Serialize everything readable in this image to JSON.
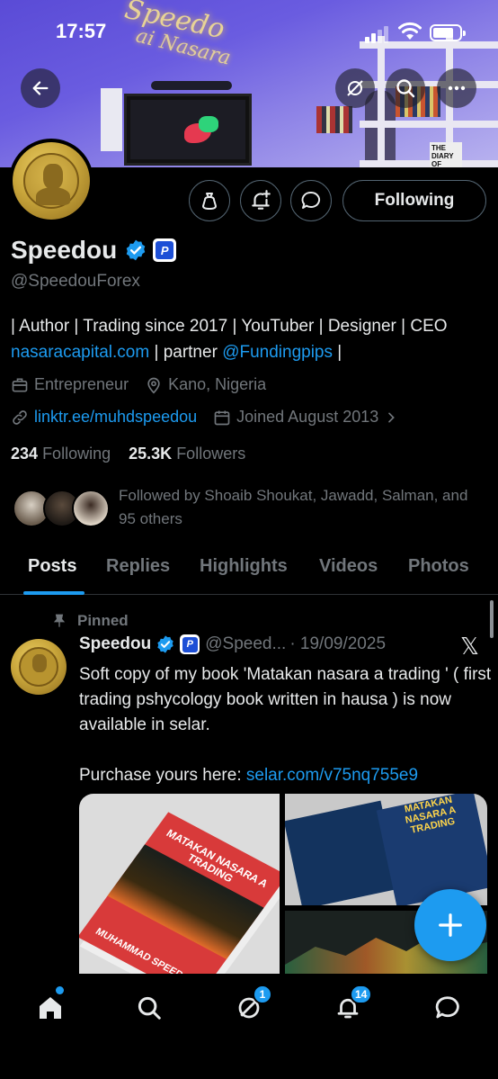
{
  "status_bar": {
    "time": "17:57"
  },
  "banner": {
    "neon_line1": "Speedo",
    "neon_line2": "ai Nasara",
    "book_cover": "THE DIARY OF"
  },
  "header": {
    "back_icon": "arrow-left-icon",
    "actions": [
      "translate-off-icon",
      "search-icon",
      "more-icon"
    ]
  },
  "profile": {
    "name": "Speedou",
    "handle": "@SpeedouForex",
    "affiliate_badge": "P",
    "following_button": "Following",
    "bio_line1": "| Author | Trading since 2017 | YouTuber | Designer | CEO",
    "bio_link1": "nasaracapital.com",
    "bio_mid": " | partner ",
    "bio_link2": "@Fundingpips",
    "bio_end": " |",
    "category": "Entrepreneur",
    "location": "Kano, Nigeria",
    "website": "linktr.ee/muhdspeedou",
    "joined": "Joined August 2013",
    "following_count": "234",
    "following_label": "Following",
    "followers_count": "25.3K",
    "followers_label": "Followers",
    "followed_by": "Followed by Shoaib Shoukat, Jawadd, Salman, and 95 others"
  },
  "tabs": [
    {
      "label": "Posts",
      "active": true
    },
    {
      "label": "Replies"
    },
    {
      "label": "Highlights"
    },
    {
      "label": "Videos"
    },
    {
      "label": "Photos"
    }
  ],
  "post": {
    "pinned_label": "Pinned",
    "author": "Speedou",
    "handle": "@Speed...",
    "date": "· 19/09/2025",
    "text_line1": "Soft copy of my book 'Matakan nasara a trading ' ( first trading pshycology book written in hausa ) is now available in selar.",
    "text_line2_prefix": "Purchase yours here: ",
    "text_link": "selar.com/v75nq755e9",
    "media_book_title": "MATAKAN NASARA A TRADING",
    "media_book_author": "MUHAMMAD SPEEDOU",
    "media_book2_title": "MATAKAN NASARA A TRADING"
  },
  "bottom_nav": {
    "items": [
      "home-icon",
      "search-icon",
      "grok-icon",
      "notifications-icon",
      "messages-icon"
    ],
    "grok_badge": "1",
    "notifications_badge": "14"
  },
  "colors": {
    "accent": "#1d9bf0",
    "background": "#000000",
    "muted": "#71767b"
  }
}
